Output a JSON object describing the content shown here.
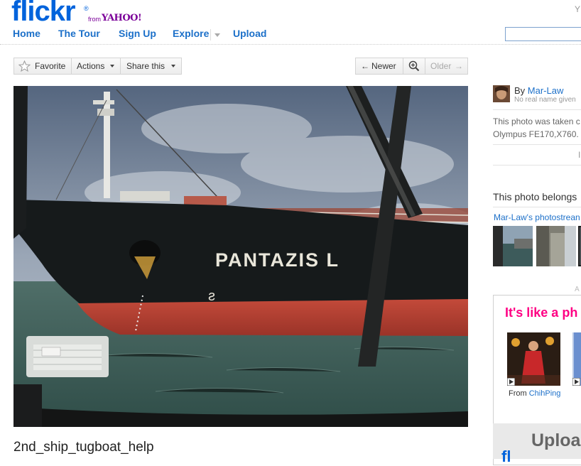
{
  "header": {
    "logo_text": "flickr",
    "logo_registered": "®",
    "logo_from": "from",
    "logo_yahoo": "YAHOO!",
    "partial_right_text": "Y",
    "nav": [
      {
        "label": "Home"
      },
      {
        "label": "The Tour"
      },
      {
        "label": "Sign Up"
      },
      {
        "label": "Explore"
      },
      {
        "label": "Upload"
      }
    ],
    "search": {
      "value": "",
      "placeholder": ""
    }
  },
  "toolbar": {
    "favorite_label": "Favorite",
    "actions_label": "Actions",
    "share_label": "Share this",
    "newer_label": "Newer",
    "older_label": "Older",
    "newer_arrow": "←",
    "older_arrow": "→"
  },
  "photo": {
    "title": "2nd_ship_tugboat_help",
    "ship_name": "PANTAZIS L",
    "hull_mark": "ƨ"
  },
  "sidebar": {
    "by_prefix": "By",
    "owner": "Mar-Law",
    "real_name_note": "No real name given",
    "camera_line1": "This photo was taken c",
    "camera_line2": "Olympus FE170,X760.",
    "more_marker": "I",
    "belongs_heading": "This photo belongs",
    "photostream_link": "Mar-Law's photostrean"
  },
  "ad": {
    "label": "A",
    "headline": "It's like a ph",
    "from_prefix": "From",
    "from_user": "ChihPing",
    "upload_text": "Uploa",
    "fl_text": "fl"
  },
  "colors": {
    "flickr_blue": "#0063dc",
    "link_blue": "#1c70c9",
    "yahoo_purple": "#7b0099",
    "ad_pink": "#ff0084"
  }
}
